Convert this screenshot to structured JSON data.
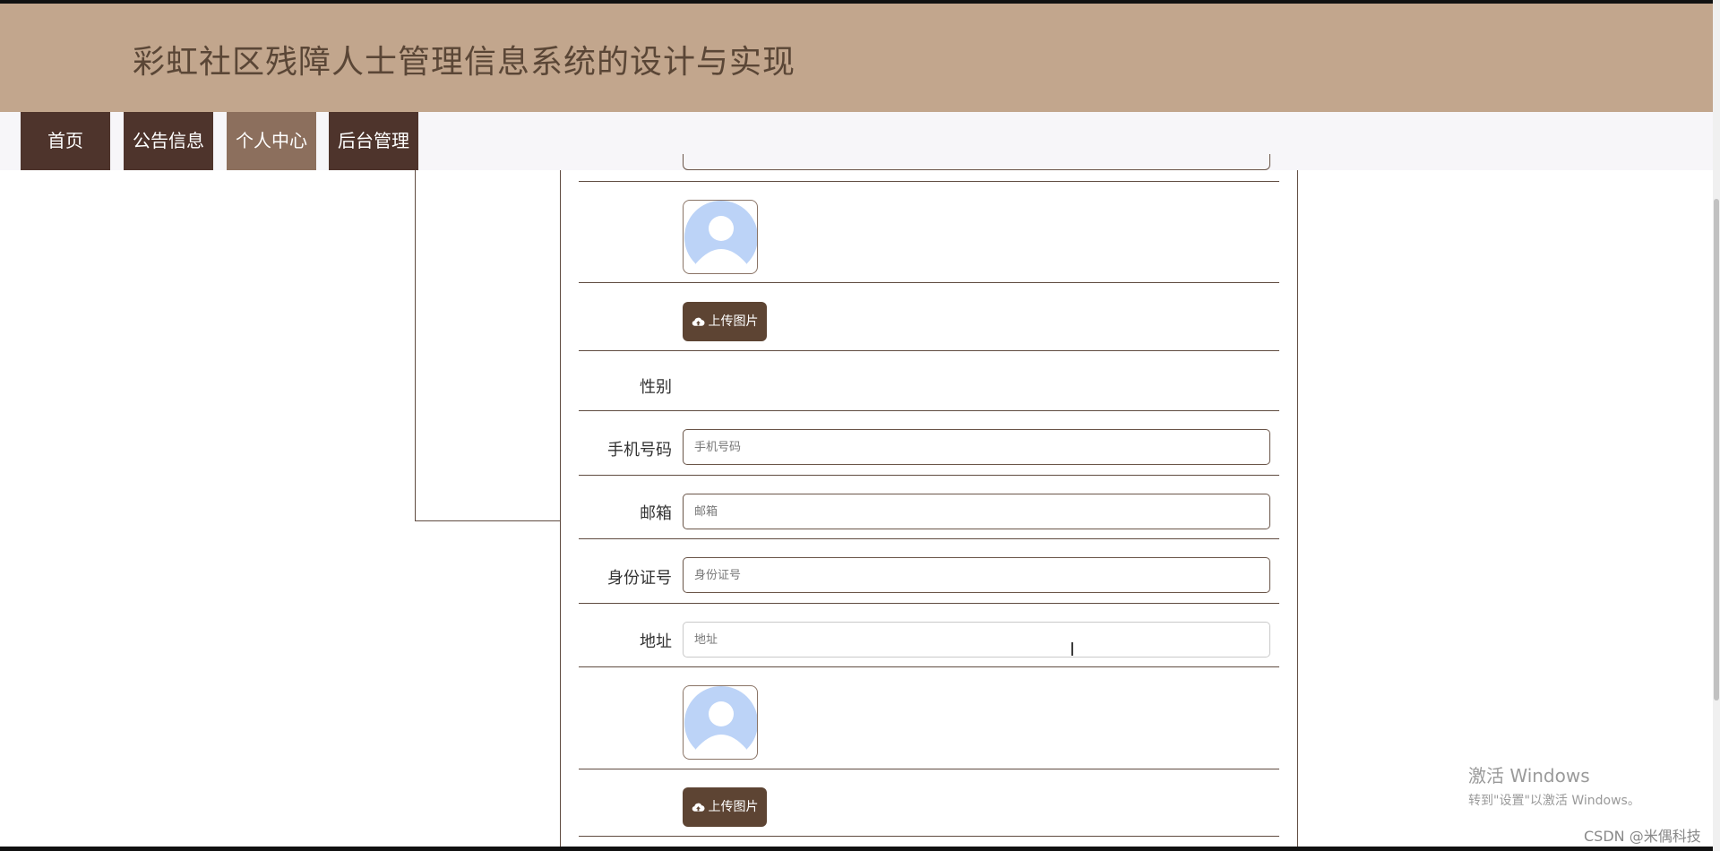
{
  "header": {
    "title": "彩虹社区残障人士管理信息系统的设计与实现"
  },
  "nav": {
    "items": [
      {
        "label": "首页",
        "active": false
      },
      {
        "label": "公告信息",
        "active": false
      },
      {
        "label": "个人中心",
        "active": true
      },
      {
        "label": "后台管理",
        "active": false
      }
    ]
  },
  "form": {
    "upload_label": "上传图片",
    "gender_label": "性别",
    "phone": {
      "label": "手机号码",
      "placeholder": "手机号码",
      "value": ""
    },
    "email": {
      "label": "邮箱",
      "placeholder": "邮箱",
      "value": ""
    },
    "id_number": {
      "label": "身份证号",
      "placeholder": "身份证号",
      "value": ""
    },
    "address": {
      "label": "地址",
      "placeholder": "地址",
      "value": ""
    }
  },
  "system": {
    "activate_title": "激活 Windows",
    "activate_sub": "转到\"设置\"以激活 Windows。",
    "watermark": "CSDN @米偶科技"
  },
  "colors": {
    "header_bg": "#c2a68d",
    "nav_bg": "#4e342c",
    "nav_active_bg": "#8c6f5d",
    "button_bg": "#5d4433",
    "border": "#5f4b40"
  },
  "icons": {
    "avatar": "user-avatar-icon",
    "upload": "cloud-upload-icon"
  }
}
